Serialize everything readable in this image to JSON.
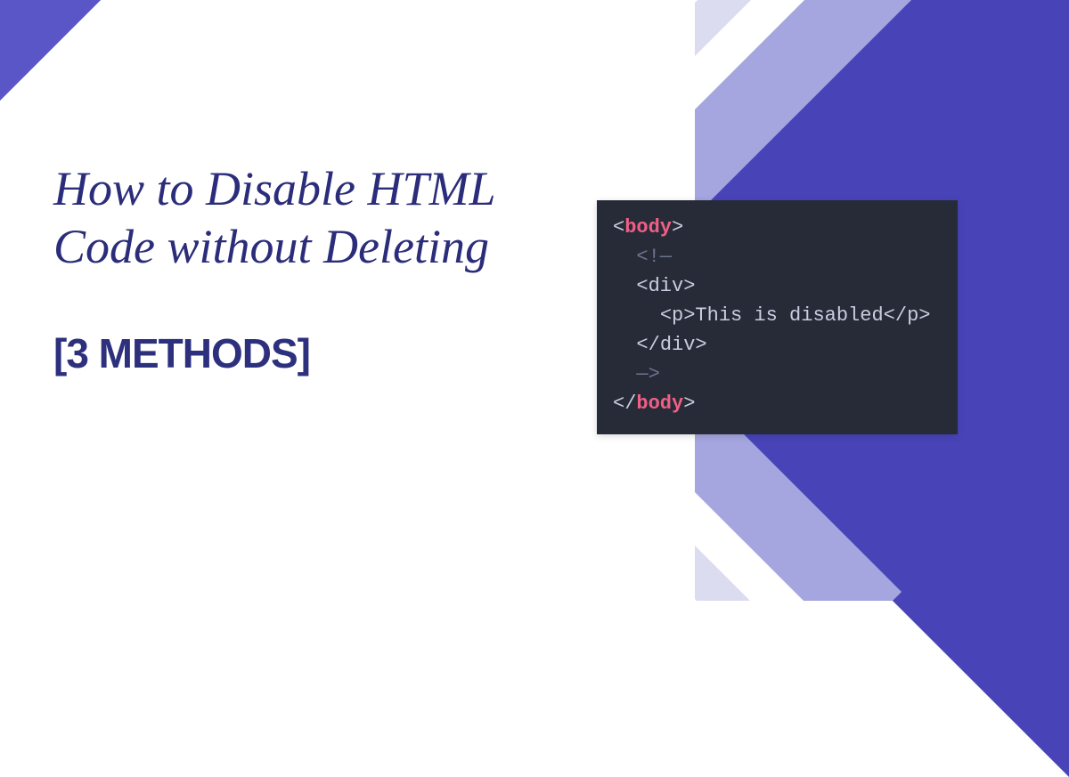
{
  "title": "How to Disable HTML Code without Deleting",
  "subtitle": "[3 METHODS]",
  "code": {
    "line1_open": "<",
    "line1_tag": "body",
    "line1_close": ">",
    "line2_comment_open": "<!—",
    "line3_open": "<",
    "line3_tag": "div",
    "line3_close": ">",
    "line4_popen": "<",
    "line4_ptag": "p",
    "line4_pclosebr": ">",
    "line4_text": "This is disabled",
    "line4_pend_open": "</",
    "line4_pend_tag": "p",
    "line4_pend_close": ">",
    "line5_open": "</",
    "line5_tag": "div",
    "line5_close": ">",
    "line6_comment_close": "—>",
    "line7_open": "</",
    "line7_tag": "body",
    "line7_close": ">"
  }
}
